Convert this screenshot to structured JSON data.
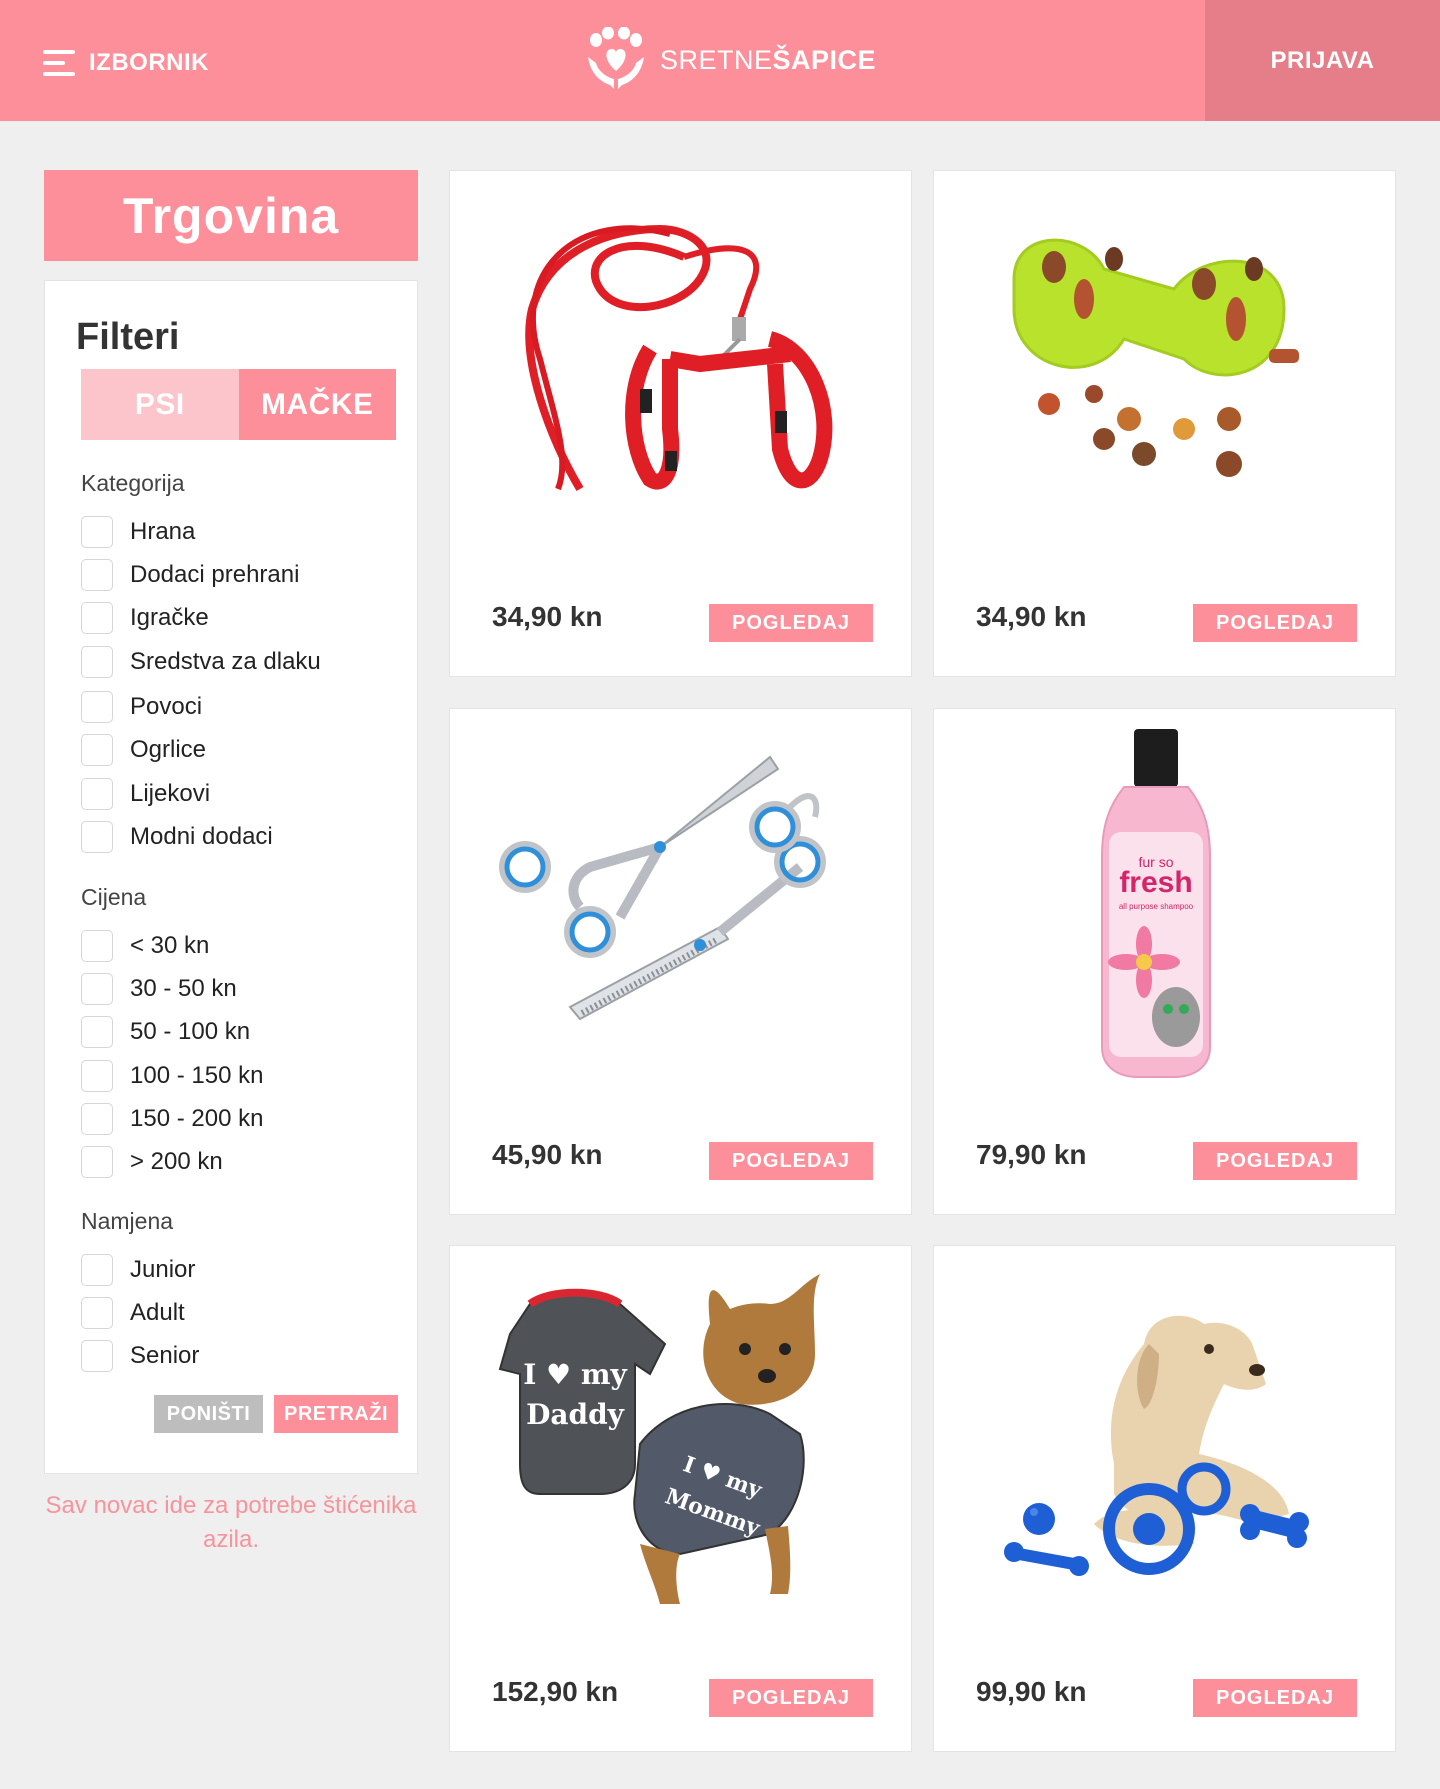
{
  "header": {
    "menu_label": "IZBORNIK",
    "logo_regular": "SRETNE",
    "logo_bold": "ŠAPICE",
    "login_label": "PRIJAVA"
  },
  "sidebar": {
    "shop_title": "Trgovina",
    "filters_title": "Filteri",
    "species_tabs": [
      "PSI",
      "MAČKE"
    ],
    "sections": {
      "category": {
        "label": "Kategorija",
        "options": [
          "Hrana",
          "Dodaci prehrani",
          "Igračke",
          "Sredstva za dlaku",
          "Povoci",
          "Ogrlice",
          "Lijekovi",
          "Modni dodaci"
        ]
      },
      "price": {
        "label": "Cijena",
        "options": [
          "< 30 kn",
          "30 - 50 kn",
          "50 - 100 kn",
          "100 - 150 kn",
          "150 - 200 kn",
          "> 200 kn"
        ]
      },
      "purpose": {
        "label": "Namjena",
        "options": [
          "Junior",
          "Adult",
          "Senior"
        ]
      }
    },
    "reset_label": "PONIŠTI",
    "search_label": "PRETRAŽI",
    "note": "Sav novac ide za potrebe štićenika azila."
  },
  "products": [
    {
      "price": "34,90 kn",
      "button": "POGLEDAJ",
      "icon": "leash-harness-icon"
    },
    {
      "price": "34,90 kn",
      "button": "POGLEDAJ",
      "icon": "treat-toy-icon"
    },
    {
      "price": "45,90 kn",
      "button": "POGLEDAJ",
      "icon": "grooming-scissors-icon"
    },
    {
      "price": "79,90 kn",
      "button": "POGLEDAJ",
      "icon": "shampoo-bottle-icon",
      "bottle_text": {
        "line1": "fur so",
        "line2": "fresh",
        "line3": "all purpose shampoo"
      }
    },
    {
      "price": "152,90 kn",
      "button": "POGLEDAJ",
      "icon": "dog-sweater-icon",
      "shirt_text": {
        "a1": "I ♥ my",
        "a2": "Daddy",
        "b1": "I ♥ my",
        "b2": "Mommy"
      }
    },
    {
      "price": "99,90 kn",
      "button": "POGLEDAJ",
      "icon": "dog-toys-icon"
    }
  ],
  "colors": {
    "brand_pink": "#fd8f9a",
    "login_bg": "#e67e89",
    "light_pink": "#fbc5cb",
    "reset_gray": "#bdbdbd",
    "background": "#efefef"
  }
}
